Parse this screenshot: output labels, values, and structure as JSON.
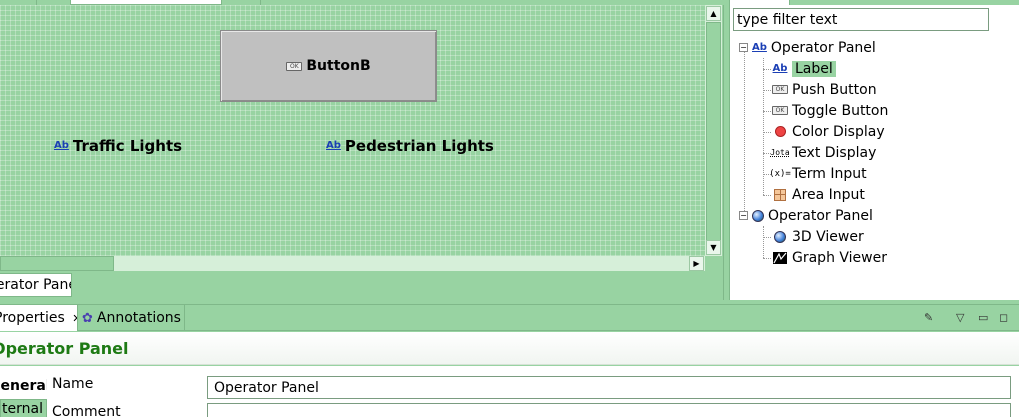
{
  "editor": {
    "canvas": {
      "button_b": {
        "label": "ButtonB",
        "icon": "ok-button-icon"
      },
      "labels": [
        {
          "text": "Traffic Lights",
          "icon": "label-ab-icon"
        },
        {
          "text": "Pedestrian Lights",
          "icon": "label-ab-icon"
        }
      ]
    },
    "bottom_tab": "Operator Panel"
  },
  "palette": {
    "filter": {
      "value": "type filter text"
    },
    "tree": {
      "group1": {
        "label": "Operator Panel",
        "items": [
          {
            "label": "Label",
            "icon": "label-ab-icon",
            "selected": true
          },
          {
            "label": "Push Button",
            "icon": "ok-button-icon"
          },
          {
            "label": "Toggle Button",
            "icon": "ok-button-icon"
          },
          {
            "label": "Color Display",
            "icon": "red-circle-icon"
          },
          {
            "label": "Text Display",
            "icon": "text-display-icon"
          },
          {
            "label": "Term Input",
            "icon": "term-input-icon"
          },
          {
            "label": "Area Input",
            "icon": "grid-icon"
          }
        ]
      },
      "group2": {
        "label": "Operator Panel",
        "items": [
          {
            "label": "3D Viewer",
            "icon": "globe-icon"
          },
          {
            "label": "Graph Viewer",
            "icon": "graph-icon"
          }
        ]
      }
    }
  },
  "properties": {
    "tabs": {
      "properties": "Properties",
      "annotations": "Annotations"
    },
    "title": "Operator Panel",
    "sections": {
      "general": "General",
      "internal": "Internal"
    },
    "fields": {
      "name_label": "Name",
      "name_value": "Operator Panel",
      "comment_label": "Comment",
      "comment_value": ""
    }
  },
  "colors": {
    "accent_green": "#98d3a2",
    "title_green": "#1e7a14",
    "label_icon_blue": "#1b3fb5"
  }
}
